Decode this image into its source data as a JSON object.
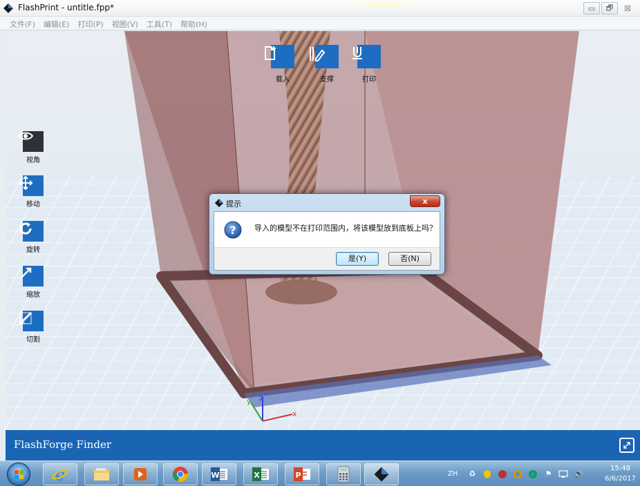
{
  "window": {
    "title": "FlashPrint - untitle.fpp*",
    "controls": [
      "▭",
      "🗗",
      "☒"
    ]
  },
  "menu": [
    "文件(F)",
    "编辑(E)",
    "打印(P)",
    "视图(V)",
    "工具(T)",
    "帮助(H)"
  ],
  "top_tools": [
    {
      "label": "载入",
      "icon": "load-file-icon"
    },
    {
      "label": "支撑",
      "icon": "support-icon"
    },
    {
      "label": "打印",
      "icon": "print-icon"
    }
  ],
  "left_tools": [
    {
      "label": "视角",
      "icon": "eye-icon"
    },
    {
      "label": "移动",
      "icon": "move-icon"
    },
    {
      "label": "旋转",
      "icon": "rotate-icon"
    },
    {
      "label": "缩放",
      "icon": "scale-icon"
    },
    {
      "label": "切割",
      "icon": "cut-icon"
    }
  ],
  "axes": {
    "x": "x",
    "y": "y",
    "z": "z"
  },
  "dialog": {
    "title": "提示",
    "close_label": "x",
    "icon": "question-icon",
    "message": "导入的模型不在打印范围内，将该模型放到底板上吗？",
    "yes_label": "是(Y)",
    "no_label": "否(N)"
  },
  "footer": {
    "brand": "FlashForge Finder",
    "icon": "expand-icon"
  },
  "taskbar": {
    "apps": [
      "start-orb",
      "ie-icon",
      "file-explorer-icon",
      "media-player-icon",
      "chrome-icon",
      "word-icon",
      "excel-icon",
      "powerpoint-icon",
      "calculator-icon",
      "flashprint-icon"
    ],
    "word_letter": "W",
    "excel_letter": "X",
    "ppt_letter": "P",
    "language": "ZH",
    "time": "15:48",
    "date": "6/6/2017"
  },
  "colors": {
    "accent": "#1d6ec2",
    "footer": "#1965b4",
    "build_volume": "#a76f6f",
    "floor": "#dfe9f3"
  }
}
